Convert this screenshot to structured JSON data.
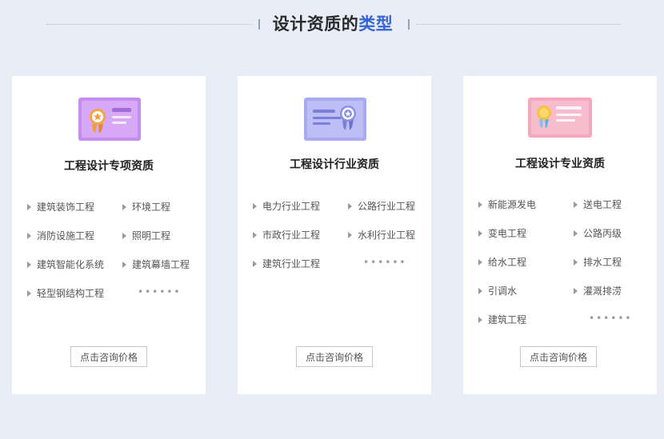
{
  "header": {
    "title_main": "设计资质的",
    "title_accent": "类型"
  },
  "colors": {
    "accent": "#3464d8",
    "card1_icon": "#c58cf0",
    "card2_icon": "#a9abf0",
    "card3_icon": "#f4a7bd",
    "background": "#e9edf7"
  },
  "cards": [
    {
      "title": "工程设计专项资质",
      "icon": "certificate-award-icon",
      "items": [
        "建筑装饰工程",
        "环境工程",
        "消防设施工程",
        "照明工程",
        "建筑智能化系统",
        "建筑幕墙工程",
        "轻型钢结构工程"
      ],
      "more": "••••••",
      "button": "点击咨询价格"
    },
    {
      "title": "工程设计行业资质",
      "icon": "certificate-seal-icon",
      "items": [
        "电力行业工程",
        "公路行业工程",
        "市政行业工程",
        "水利行业工程",
        "建筑行业工程"
      ],
      "more": "••••••",
      "button": "点击咨询价格"
    },
    {
      "title": "工程设计专业资质",
      "icon": "certificate-medal-icon",
      "items": [
        "新能源发电",
        "送电工程",
        "变电工程",
        "公路丙级",
        "给水工程",
        "排水工程",
        "引调水",
        "灌溉排涝",
        "建筑工程"
      ],
      "more": "••••••",
      "button": "点击咨询价格"
    }
  ]
}
